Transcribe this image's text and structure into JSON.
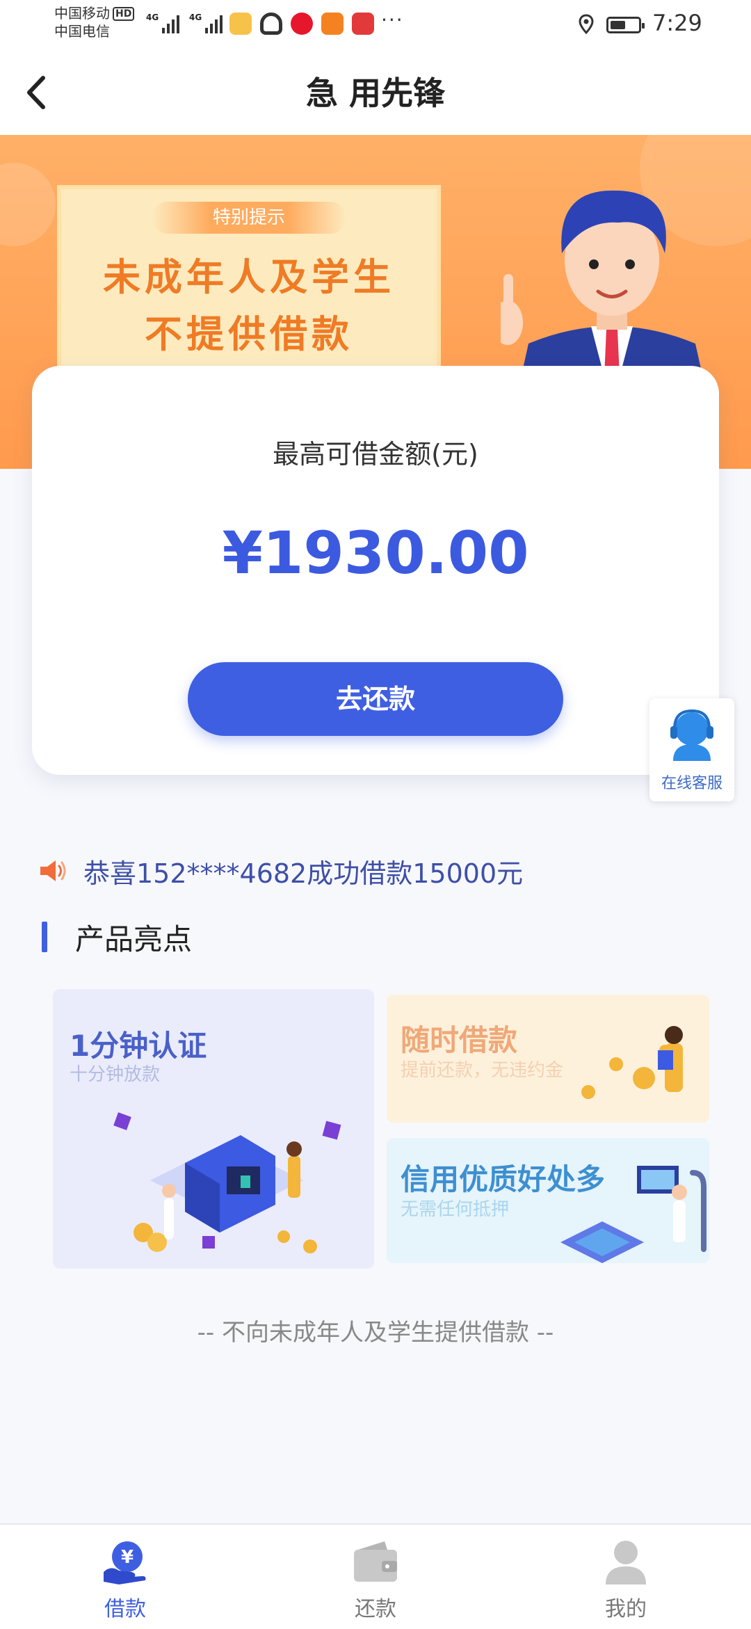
{
  "status_bar": {
    "carrier_1": "中国移动",
    "hd_badge": "HD",
    "carrier_2": "中国电信",
    "network_1": "4G",
    "network_2": "4G",
    "app_icons": [
      "mail-app-icon",
      "headphones-app-icon",
      "weibo-icon",
      "video-app-icon",
      "reader-app-icon"
    ],
    "more": "···",
    "time": "7:29",
    "battery_level": 0.55
  },
  "header": {
    "back_icon": "chevron-left-icon",
    "title": "急 用先锋"
  },
  "banner": {
    "badge": "特别提示",
    "line1": "未成年人及学生",
    "line2": "不提供借款"
  },
  "loan_card": {
    "label": "最高可借金额(元)",
    "amount": "¥1930.00",
    "button_label": "去还款"
  },
  "customer_service": {
    "label": "在线客服",
    "icon": "headset-agent-icon"
  },
  "marquee": {
    "icon": "speaker-icon",
    "text": "恭喜152****4682成功借款15000元"
  },
  "section": {
    "title": "产品亮点"
  },
  "features": [
    {
      "title": "1分钟认证",
      "subtitle": "十分钟放款"
    },
    {
      "title": "随时借款",
      "subtitle": "提前还款，无违约金"
    },
    {
      "title": "信用优质好处多",
      "subtitle": "无需任何抵押"
    }
  ],
  "footer_note": "-- 不向未成年人及学生提供借款 --",
  "bottom_nav": [
    {
      "label": "借款",
      "icon": "yen-hand-icon",
      "active": true
    },
    {
      "label": "还款",
      "icon": "wallet-icon",
      "active": false
    },
    {
      "label": "我的",
      "icon": "user-icon",
      "active": false
    }
  ],
  "colors": {
    "primary": "#3f5fe2",
    "banner_orange": "#ff9a4d",
    "notice_text": "#ef7b25",
    "marquee_text": "#3e4fa8"
  }
}
